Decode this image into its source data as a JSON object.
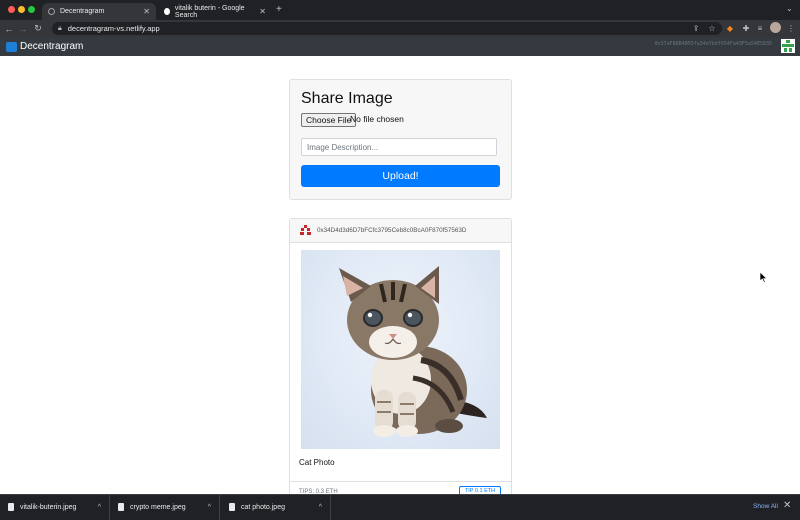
{
  "browser": {
    "tabs": [
      {
        "title": "Decentragram",
        "active": true
      },
      {
        "title": "vitalik buterin - Google Search",
        "active": false
      }
    ],
    "new_tab_icon": "+",
    "url": "decentragram-vs.netlify.app"
  },
  "app": {
    "brand": "Decentragram",
    "account": "0x37aF88B4B55fa34eYbdf654Fa43F5a54E5835"
  },
  "upload": {
    "title": "Share Image",
    "choose_file_label": "Choose File",
    "no_file_text": "No file chosen",
    "description_placeholder": "Image Description...",
    "upload_label": "Upload!"
  },
  "post": {
    "author": "0x34D4d3d6D7bFCfc3795Ceb8c0BcA0F870f57563D",
    "description": "Cat Photo",
    "tips": "TIPS: 0.3 ETH",
    "tip_label": "TIP 0.1 ETH"
  },
  "downloads": {
    "items": [
      "vitalik-buterin.jpeg",
      "crypto meme.jpeg",
      "cat photo.jpeg"
    ],
    "show_all": "Show All"
  },
  "colors": {
    "navbar": "#343a40",
    "primary": "#007bff",
    "card_bg": "#f7f7f7"
  }
}
